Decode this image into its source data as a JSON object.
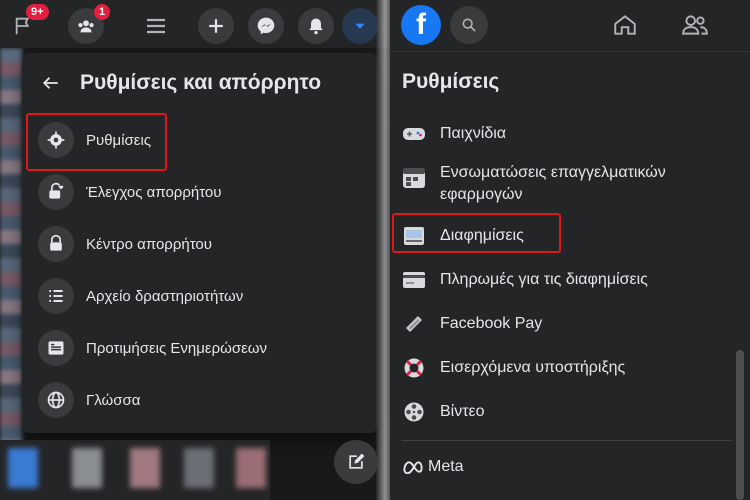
{
  "left": {
    "topbar": {
      "flag_badge": "9+",
      "groups_badge": "1"
    },
    "dropdown": {
      "title": "Ρυθμίσεις και απόρρητο",
      "items": [
        {
          "label": "Ρυθμίσεις",
          "icon": "gear-icon"
        },
        {
          "label": "Έλεγχος απορρήτου",
          "icon": "lock-heart-icon"
        },
        {
          "label": "Κέντρο απορρήτου",
          "icon": "lock-icon"
        },
        {
          "label": "Αρχείο δραστηριοτήτων",
          "icon": "list-icon"
        },
        {
          "label": "Προτιμήσεις Ενημερώσεων",
          "icon": "feed-icon"
        },
        {
          "label": "Γλώσσα",
          "icon": "globe-icon"
        }
      ]
    }
  },
  "right": {
    "logo": "f",
    "title": "Ρυθμίσεις",
    "items": [
      {
        "label": "Παιχνίδια",
        "icon": "gamepad-icon"
      },
      {
        "label": "Ενσωματώσεις επαγγελματικών εφαρμογών",
        "icon": "business-apps-icon"
      },
      {
        "label": "Διαφημίσεις",
        "icon": "ads-icon"
      },
      {
        "label": "Πληρωμές για τις διαφημίσεις",
        "icon": "credit-card-icon"
      },
      {
        "label": "Facebook Pay",
        "icon": "pay-tag-icon"
      },
      {
        "label": "Εισερχόμενα υποστήριξης",
        "icon": "lifebuoy-icon"
      },
      {
        "label": "Βίντεο",
        "icon": "film-reel-icon"
      }
    ],
    "footer": "Meta"
  },
  "colors": {
    "highlight": "#e0161b",
    "brand": "#1877f2"
  }
}
